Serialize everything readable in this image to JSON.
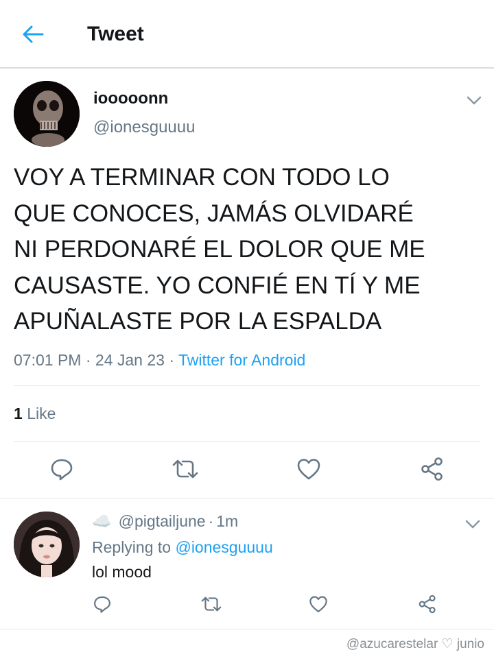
{
  "header": {
    "title": "Tweet",
    "back_icon": "arrow-left-icon"
  },
  "tweet": {
    "display_name": "iooooonn",
    "handle": "@ionesguuuu",
    "text": "VOY A TERMINAR CON TODO LO QUE CONOCES, JAMÁS OLVIDARÉ NI PERDONARÉ EL DOLOR QUE ME CAUSASTE. YO CONFIÉ EN TÍ Y ME APUÑALASTE POR LA ESPALDA",
    "time": "07:01 PM",
    "dot": "·",
    "date": "24 Jan 23",
    "source": "Twitter for Android",
    "likes_count": "1",
    "likes_label": "Like"
  },
  "reply": {
    "emoji": "☁️",
    "handle": "@pigtailjune",
    "dot": "·",
    "age": "1m",
    "replying_prefix": "Replying to",
    "replying_to": "@ionesguuuu",
    "text": "lol mood"
  },
  "watermark": "@azucarestelar ♡ junio",
  "colors": {
    "accent": "#1da1f2",
    "muted": "#657786",
    "text": "#14171a",
    "divider": "#e1e8ed"
  }
}
